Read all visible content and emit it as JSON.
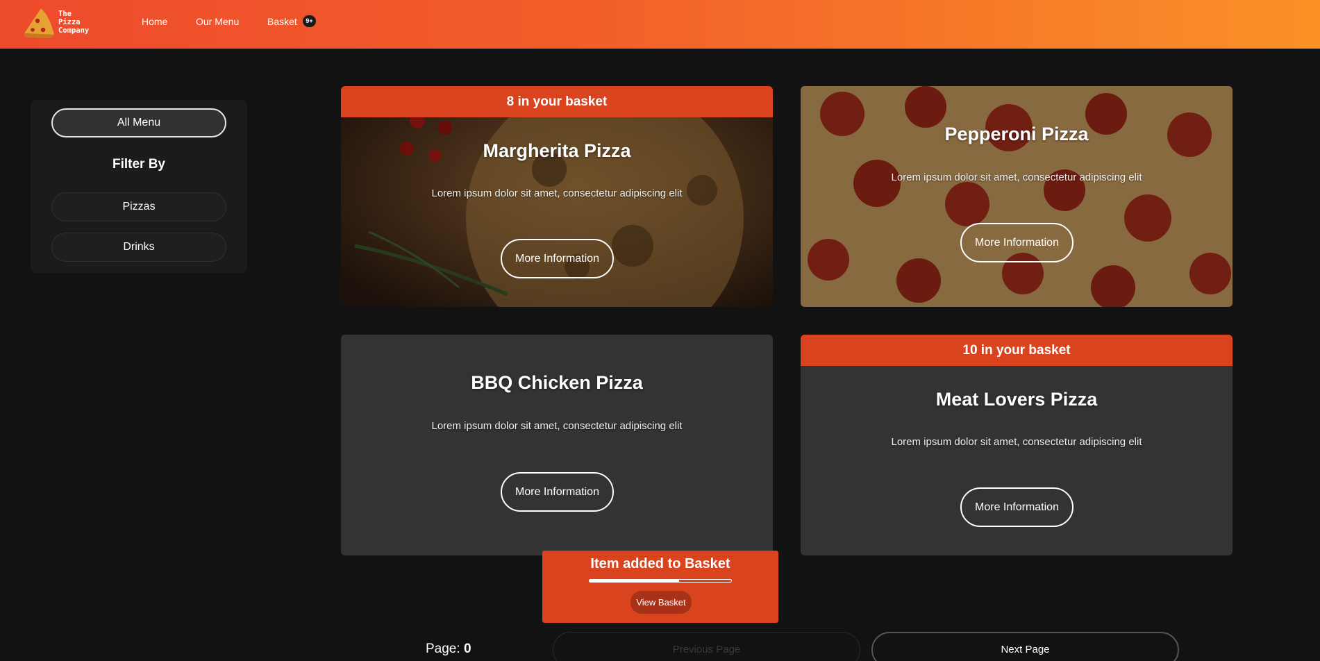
{
  "header": {
    "logo_lines": [
      "The",
      "Pizza",
      "Company"
    ],
    "nav": {
      "home": "Home",
      "menu": "Our Menu",
      "basket": "Basket"
    },
    "basket_badge": "9+",
    "gradient_colors": [
      "#ee4a2c",
      "#fb9127"
    ]
  },
  "sidebar": {
    "all_menu": "All Menu",
    "filter_title": "Filter By",
    "filters": [
      "Pizzas",
      "Drinks"
    ]
  },
  "cards": [
    {
      "banner": "8 in your basket",
      "title": "Margherita Pizza",
      "description": "Lorem ipsum dolor sit amet, consectetur adipiscing elit",
      "button": "More Information",
      "image": "margherita-pizza-photo"
    },
    {
      "banner": "",
      "title": "Pepperoni Pizza",
      "description": "Lorem ipsum dolor sit amet, consectetur adipiscing elit",
      "button": "More Information",
      "image": "pepperoni-pizza-photo"
    },
    {
      "banner": "",
      "title": "BBQ Chicken Pizza",
      "description": "Lorem ipsum dolor sit amet, consectetur adipiscing elit",
      "button": "More Information",
      "image": ""
    },
    {
      "banner": "10 in your basket",
      "title": "Meat Lovers Pizza",
      "description": "Lorem ipsum dolor sit amet, consectetur adipiscing elit",
      "button": "More Information",
      "image": ""
    }
  ],
  "toast": {
    "title": "Item added to Basket",
    "progress": 0.63,
    "button": "View Basket",
    "color": "#d9431e"
  },
  "pagination": {
    "label": "Page:",
    "page": "0",
    "prev": "Previous Page",
    "next": "Next Page"
  },
  "colors": {
    "accent": "#d9431e",
    "background": "#121212",
    "card": "#333333"
  }
}
